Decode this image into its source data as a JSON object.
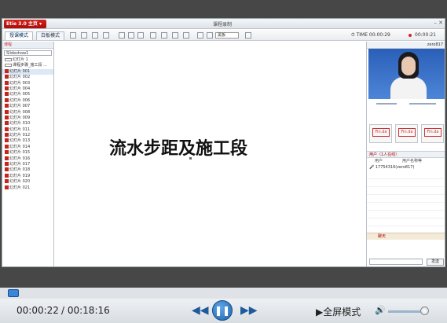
{
  "app": {
    "logo": "Etie 3.0 主页 ▾",
    "title": "课程录制",
    "window_controls": "– ✕"
  },
  "toolbar": {
    "tab1": "授课模式",
    "tab2": "白板模式",
    "mode_select": "黑板",
    "time_label": "TIME",
    "time_value": "00:00:29",
    "rec_time": "00:00:21"
  },
  "left": {
    "header": "课程",
    "select": "Slideshow1",
    "items": [
      "幻灯片 1",
      "课程步骤_施工段 ...",
      "幻灯片 001",
      "幻灯片 002",
      "幻灯片 003",
      "幻灯片 004",
      "幻灯片 005",
      "幻灯片 006",
      "幻灯片 007",
      "幻灯片 008",
      "幻灯片 009",
      "幻灯片 010",
      "幻灯片 011",
      "幻灯片 012",
      "幻灯片 013",
      "幻灯片 014",
      "幻灯片 015",
      "幻灯片 016",
      "幻灯片 017",
      "幻灯片 018",
      "幻灯片 019",
      "幻灯片 020",
      "幻灯片 021"
    ]
  },
  "slide": {
    "title": "流水步距及施工段"
  },
  "right": {
    "video_user": "zero817",
    "thumb_label": "Fin.da",
    "users_header": "用户（1人在线）",
    "col1": "用户",
    "col2": "用户名称等",
    "user_entry": "17754316(zero817)",
    "chat_header": "聊天",
    "send": "发送"
  },
  "player": {
    "current": "00:00:22",
    "total": "/ 00:18:16",
    "rewind": "◀◀",
    "play": "❚❚",
    "forward": "▶▶",
    "fullscreen": "▶全屏模式",
    "progress": 0.02,
    "volume": 0.9
  }
}
